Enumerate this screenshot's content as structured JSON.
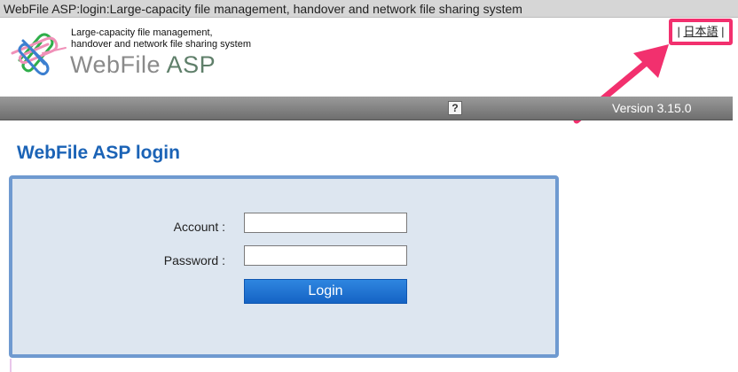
{
  "window": {
    "title": "WebFile ASP:login:Large-capacity file management, handover and network file sharing system"
  },
  "header": {
    "tagline_line1": "Large-capacity file management,",
    "tagline_line2": "handover and network file sharing system",
    "brand_main": "WebFile",
    "brand_suffix": "ASP",
    "language_prefix": "|",
    "language_link": "日本語",
    "language_suffix": "|"
  },
  "toolbar": {
    "help_label": "?",
    "version": "Version 3.15.0"
  },
  "main": {
    "heading": "WebFile ASP login"
  },
  "login_form": {
    "account_label": "Account :",
    "account_value": "",
    "password_label": "Password :",
    "password_value": "",
    "submit_label": "Login"
  },
  "colors": {
    "accent_blue": "#1b63b6",
    "highlight_pink": "#f2306e",
    "panel_background": "#dde6f0",
    "panel_border": "#6f9ad0"
  },
  "icons": [
    "paperclip-logo-icon",
    "help-icon",
    "annotation-arrow-icon"
  ]
}
